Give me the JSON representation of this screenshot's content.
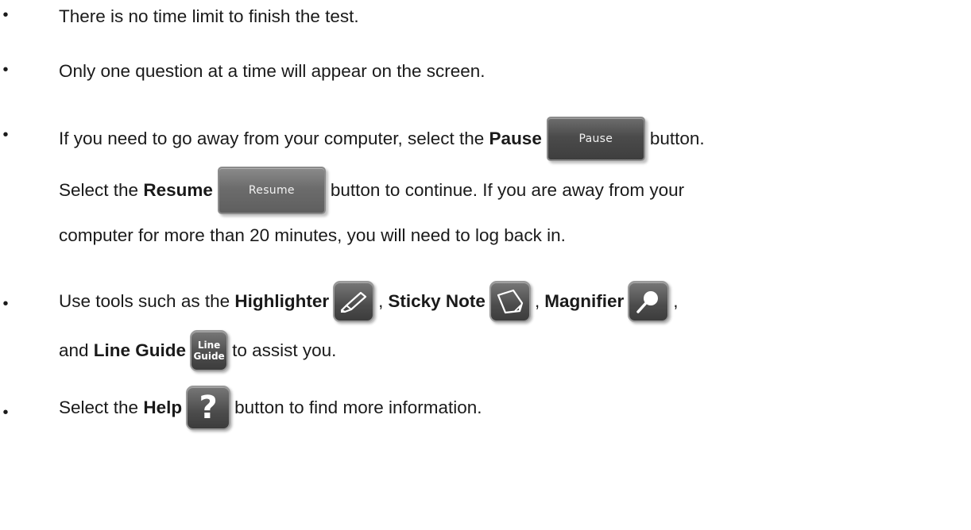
{
  "bullets": {
    "symbol": "•",
    "item1": {
      "text": "There is no time limit to finish the test."
    },
    "item2": {
      "text": "Only one question at a time will appear on the screen."
    },
    "item3": {
      "line1_pre": "If you need to go away from your computer, select the ",
      "pause_bold": "Pause",
      "pause_button_label": "Pause",
      "line1_post": "button.",
      "line2_pre": "Select the ",
      "resume_bold": "Resume",
      "resume_button_label": "Resume",
      "line2_post": "button to continue. If you are away from your",
      "line3": "computer for more than 20 minutes, you will need to log back in."
    },
    "item4": {
      "line1_pre": "Use tools such as the ",
      "highlighter_bold": "Highlighter",
      "comma1": ",",
      "sticky_bold": "Sticky Note",
      "comma2": ",",
      "magnifier_bold": "Magnifier",
      "comma3": ",",
      "line2_pre": "and ",
      "lineguide_bold": "Line Guide",
      "lineguide_icon_line1": "Line",
      "lineguide_icon_line2": "Guide",
      "line2_post": "to assist you."
    },
    "item5": {
      "pre": "Select the ",
      "help_bold": "Help",
      "help_icon_glyph": "?",
      "post": "button to find more information."
    }
  },
  "icons": {
    "highlighter": "highlighter-icon",
    "sticky_note": "sticky-note-icon",
    "magnifier": "magnifier-icon",
    "line_guide": "line-guide-icon",
    "help": "help-icon"
  }
}
